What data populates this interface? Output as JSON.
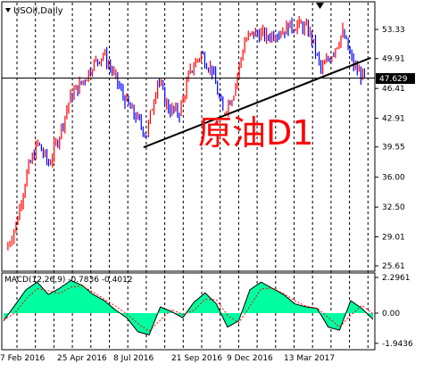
{
  "window": {
    "title": "USOil,Daily",
    "macd_label": "MACD(12,26,9) -0.7836 -0.4012",
    "overlay_text": "原油D1"
  },
  "price_axis": {
    "ticks": [
      "53.33",
      "49.91",
      "46.41",
      "42.91",
      "39.55",
      "36.00",
      "32.50",
      "29.01",
      "25.61"
    ],
    "current_price": "47.629"
  },
  "macd_axis": {
    "ticks": [
      "2.2961",
      "0.00",
      "-1.9436"
    ]
  },
  "time_axis": {
    "labels": [
      "7 Feb 2016",
      "25 Apr 2016",
      "8 Jul 2016",
      "21 Sep 2016",
      "9 Dec 2016",
      "13 Mar 2017"
    ]
  },
  "colors": {
    "bull": "#ff0000",
    "bear": "#0000ff",
    "macd_fill": "#00ffa0",
    "grid": "#000000",
    "text_red": "#ff0000"
  },
  "chart_data": [
    {
      "type": "line",
      "title": "USOil,Daily",
      "description_free": true,
      "x": [
        "7 Feb 2016",
        "25 Apr 2016",
        "8 Jul 2016",
        "21 Sep 2016",
        "9 Dec 2016",
        "13 Mar 2017"
      ],
      "series": [
        {
          "name": "",
          "points": [
            [
              "2016-02-07",
              27.5
            ],
            [
              "2016-02-20",
              30.5
            ],
            [
              "2016-03-05",
              36.5
            ],
            [
              "2016-03-19",
              40.0
            ],
            [
              "2016-04-02",
              37.5
            ],
            [
              "2016-04-16",
              41.0
            ],
            [
              "2016-04-30",
              45.5
            ],
            [
              "2016-05-14",
              47.0
            ],
            [
              "2016-05-28",
              49.0
            ],
            [
              "2016-06-11",
              50.5
            ],
            [
              "2016-06-25",
              48.0
            ],
            [
              "2016-07-09",
              45.0
            ],
            [
              "2016-07-23",
              43.0
            ],
            [
              "2016-08-06",
              41.0
            ],
            [
              "2016-08-20",
              47.5
            ],
            [
              "2016-09-03",
              44.0
            ],
            [
              "2016-09-17",
              43.5
            ],
            [
              "2016-10-01",
              48.5
            ],
            [
              "2016-10-15",
              50.5
            ],
            [
              "2016-10-29",
              48.5
            ],
            [
              "2016-11-12",
              43.5
            ],
            [
              "2016-11-26",
              46.0
            ],
            [
              "2016-12-10",
              52.0
            ],
            [
              "2016-12-24",
              53.0
            ],
            [
              "2017-01-07",
              52.5
            ],
            [
              "2017-01-21",
              53.0
            ],
            [
              "2017-02-04",
              53.5
            ],
            [
              "2017-02-18",
              54.0
            ],
            [
              "2017-03-04",
              53.0
            ],
            [
              "2017-03-18",
              48.5
            ],
            [
              "2017-04-01",
              50.5
            ],
            [
              "2017-04-15",
              53.0
            ],
            [
              "2017-04-29",
              49.0
            ],
            [
              "2017-05-13",
              47.6
            ]
          ]
        }
      ],
      "trendline": {
        "from": [
          "2016-08-02",
          39.5
        ],
        "to": [
          "2017-05-21",
          50.0
        ]
      },
      "hline": 47.629,
      "ylim": [
        25.61,
        55.5
      ],
      "grid": true
    },
    {
      "type": "area",
      "title": "MACD(12,26,9)",
      "series": [
        {
          "name": "",
          "values": [
            -0.5,
            0.5,
            1.5,
            2.0,
            1.2,
            1.6,
            2.1,
            1.8,
            1.2,
            0.8,
            0.2,
            -0.3,
            -1.2,
            -1.4,
            0.4,
            0.1,
            -0.3,
            0.7,
            1.3,
            0.6,
            -0.9,
            -0.5,
            1.5,
            2.0,
            1.6,
            1.2,
            0.6,
            0.4,
            0.3,
            -0.9,
            -1.1,
            0.8,
            0.3,
            -0.4
          ]
        }
      ],
      "ylim": [
        -1.9436,
        2.2961
      ]
    }
  ]
}
